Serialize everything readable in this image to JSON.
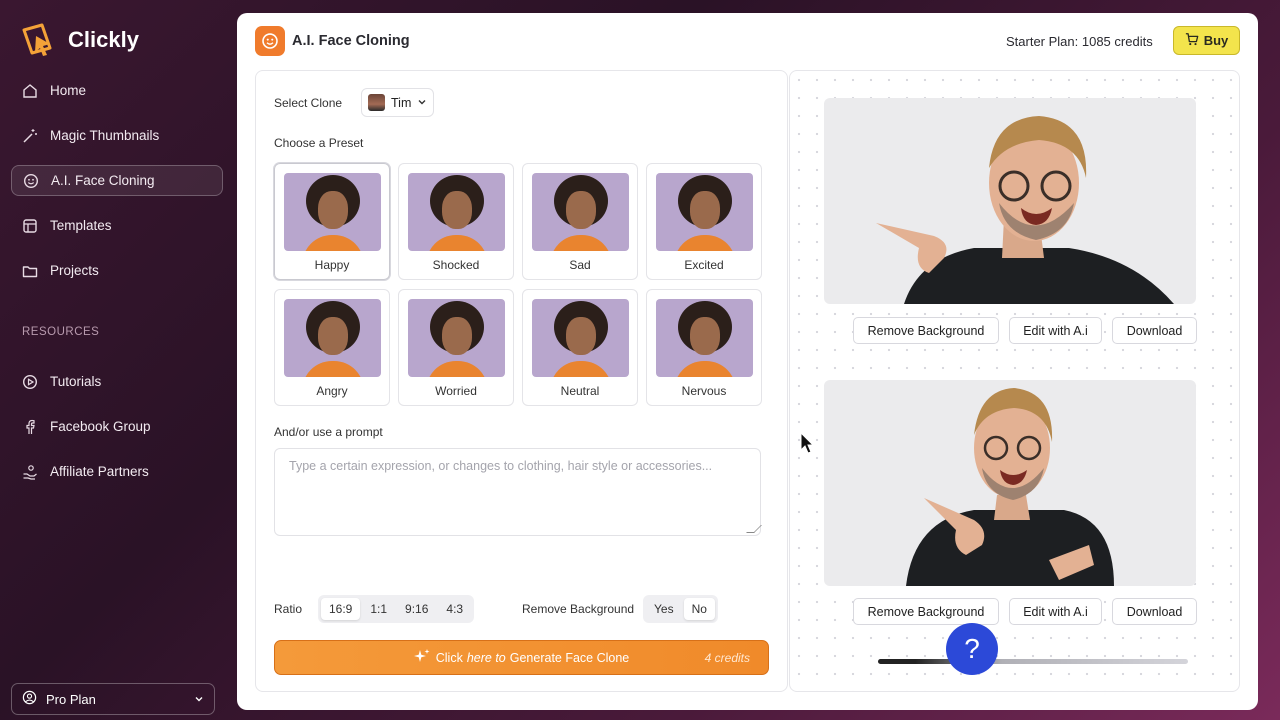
{
  "app": {
    "name": "Clickly"
  },
  "sidebar": {
    "items": [
      {
        "label": "Home",
        "icon": "home-icon"
      },
      {
        "label": "Magic Thumbnails",
        "icon": "magic-wand-icon"
      },
      {
        "label": "A.I. Face Cloning",
        "icon": "smile-icon",
        "active": true
      },
      {
        "label": "Templates",
        "icon": "layout-icon"
      },
      {
        "label": "Projects",
        "icon": "folder-icon"
      }
    ],
    "resources_label": "RESOURCES",
    "resources": [
      {
        "label": "Tutorials",
        "icon": "play-circle-icon"
      },
      {
        "label": "Facebook Group",
        "icon": "facebook-icon"
      },
      {
        "label": "Affiliate Partners",
        "icon": "handshake-icon"
      }
    ],
    "plan": "Pro Plan"
  },
  "header": {
    "title": "A.I. Face Cloning",
    "credits": "Starter Plan: 1085 credits",
    "buy_label": "Buy"
  },
  "form": {
    "select_clone_label": "Select Clone",
    "clone_value": "Tim",
    "preset_label": "Choose a Preset",
    "presets": [
      "Happy",
      "Shocked",
      "Sad",
      "Excited",
      "Angry",
      "Worried",
      "Neutral",
      "Nervous"
    ],
    "selected_preset": "Happy",
    "prompt_label": "And/or use a prompt",
    "prompt_placeholder": "Type a certain expression, or changes to clothing, hair style or accessories...",
    "ratio_label": "Ratio",
    "ratios": [
      "16:9",
      "1:1",
      "9:16",
      "4:3"
    ],
    "selected_ratio": "16:9",
    "remove_bg_label": "Remove Background",
    "remove_bg_options": [
      "Yes",
      "No"
    ],
    "remove_bg_selected": "No",
    "generate": {
      "prefix": "Click",
      "emph": "here to",
      "suffix": "Generate Face Clone",
      "cost": "4 credits"
    }
  },
  "results": {
    "actions": [
      "Remove Background",
      "Edit with A.i",
      "Download"
    ]
  },
  "colors": {
    "accent": "#f08a2a",
    "buy": "#f3e44c",
    "help": "#2c49d8"
  }
}
